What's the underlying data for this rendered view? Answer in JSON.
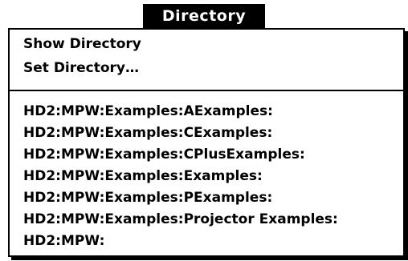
{
  "menu": {
    "title": "Directory",
    "commands": [
      {
        "label": "Show Directory"
      },
      {
        "label": "Set Directory…"
      }
    ],
    "directories": [
      {
        "label": "HD2:MPW:Examples:AExamples:"
      },
      {
        "label": "HD2:MPW:Examples:CExamples:"
      },
      {
        "label": "HD2:MPW:Examples:CPlusExamples:"
      },
      {
        "label": "HD2:MPW:Examples:Examples:"
      },
      {
        "label": "HD2:MPW:Examples:PExamples:"
      },
      {
        "label": "HD2:MPW:Examples:Projector Examples:"
      },
      {
        "label": "HD2:MPW:"
      }
    ]
  },
  "colors": {
    "foreground": "#000000",
    "background": "#ffffff"
  }
}
